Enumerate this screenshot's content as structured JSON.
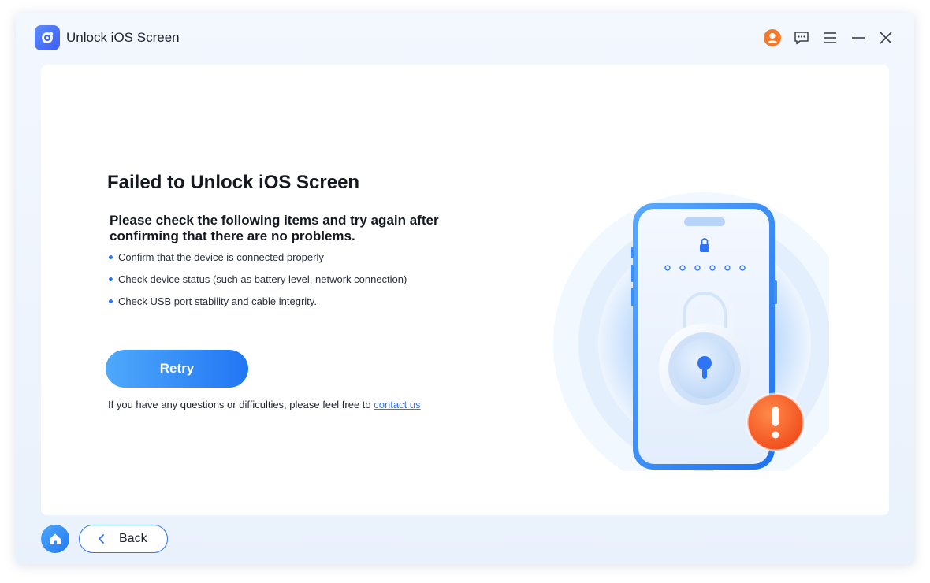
{
  "app": {
    "title": "Unlock iOS Screen",
    "accent": "#2f74f4"
  },
  "titlebar": {
    "icons": [
      "account-icon",
      "feedback-icon",
      "menu-icon",
      "minimize-icon",
      "close-icon"
    ]
  },
  "main": {
    "heading": "Failed to Unlock iOS Screen",
    "subheading": "Please check the following items and try again after confirming that there are no problems.",
    "checklist": [
      "Confirm that the device is connected properly",
      "Check device status (such as battery level, network connection)",
      "Check USB port stability and cable integrity."
    ],
    "retry_label": "Retry",
    "help_text": "If you have any questions or difficulties, please feel free to",
    "help_link": "contact us"
  },
  "footer": {
    "back_label": "Back"
  },
  "colors": {
    "error": "#f4511e",
    "primary_gradient_start": "#4ea9fb",
    "primary_gradient_end": "#2176f3"
  }
}
